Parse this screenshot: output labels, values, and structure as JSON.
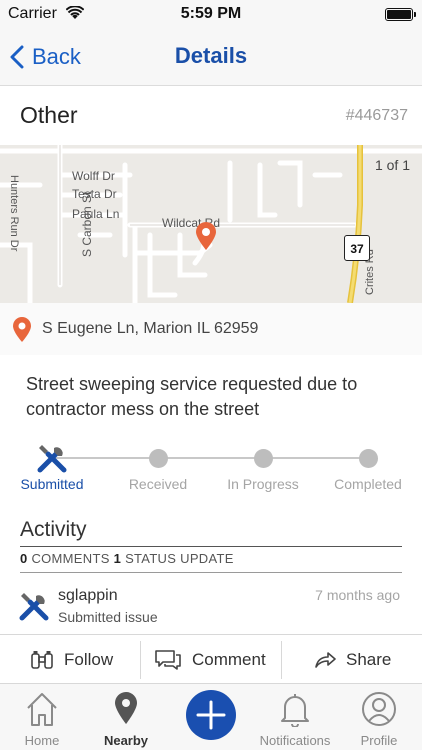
{
  "status_bar": {
    "carrier": "Carrier",
    "time": "5:59 PM"
  },
  "nav": {
    "back_label": "Back",
    "title": "Details"
  },
  "issue": {
    "category": "Other",
    "id": "#446737",
    "address": "S Eugene Ln, Marion IL 62959",
    "description": "Street sweeping service requested due to contractor mess on the street"
  },
  "map": {
    "page_count": "1 of 1",
    "labels": {
      "wolff": "Wolff Dr",
      "testa": "Testa Dr",
      "paula": "Paula Ln",
      "wildcat": "Wildcat Rd",
      "carbon": "S Carbon St",
      "hunters": "Hunters Run Dr",
      "crites": "Crites Rd",
      "route": "37"
    }
  },
  "progress": {
    "steps": [
      {
        "label": "Submitted",
        "active": true
      },
      {
        "label": "Received",
        "active": false
      },
      {
        "label": "In Progress",
        "active": false
      },
      {
        "label": "Completed",
        "active": false
      }
    ]
  },
  "activity": {
    "title": "Activity",
    "comments_count": "0",
    "comments_label": "COMMENTS",
    "status_count": "1",
    "status_label": "STATUS UPDATE",
    "items": [
      {
        "user": "sglappin",
        "action": "Submitted issue",
        "time": "7 months ago"
      }
    ]
  },
  "actions": {
    "follow": "Follow",
    "comment": "Comment",
    "share": "Share"
  },
  "tabs": [
    {
      "label": "Home",
      "icon": "home-icon"
    },
    {
      "label": "Nearby",
      "icon": "location-pin-icon",
      "active": true
    },
    {
      "label": "Notifications",
      "icon": "bell-icon"
    },
    {
      "label": "Profile",
      "icon": "user-icon"
    }
  ],
  "colors": {
    "accent": "#1a4fa8",
    "fab": "#1a4fb0",
    "pin": "#e8663c",
    "route": "#f2d35a"
  }
}
